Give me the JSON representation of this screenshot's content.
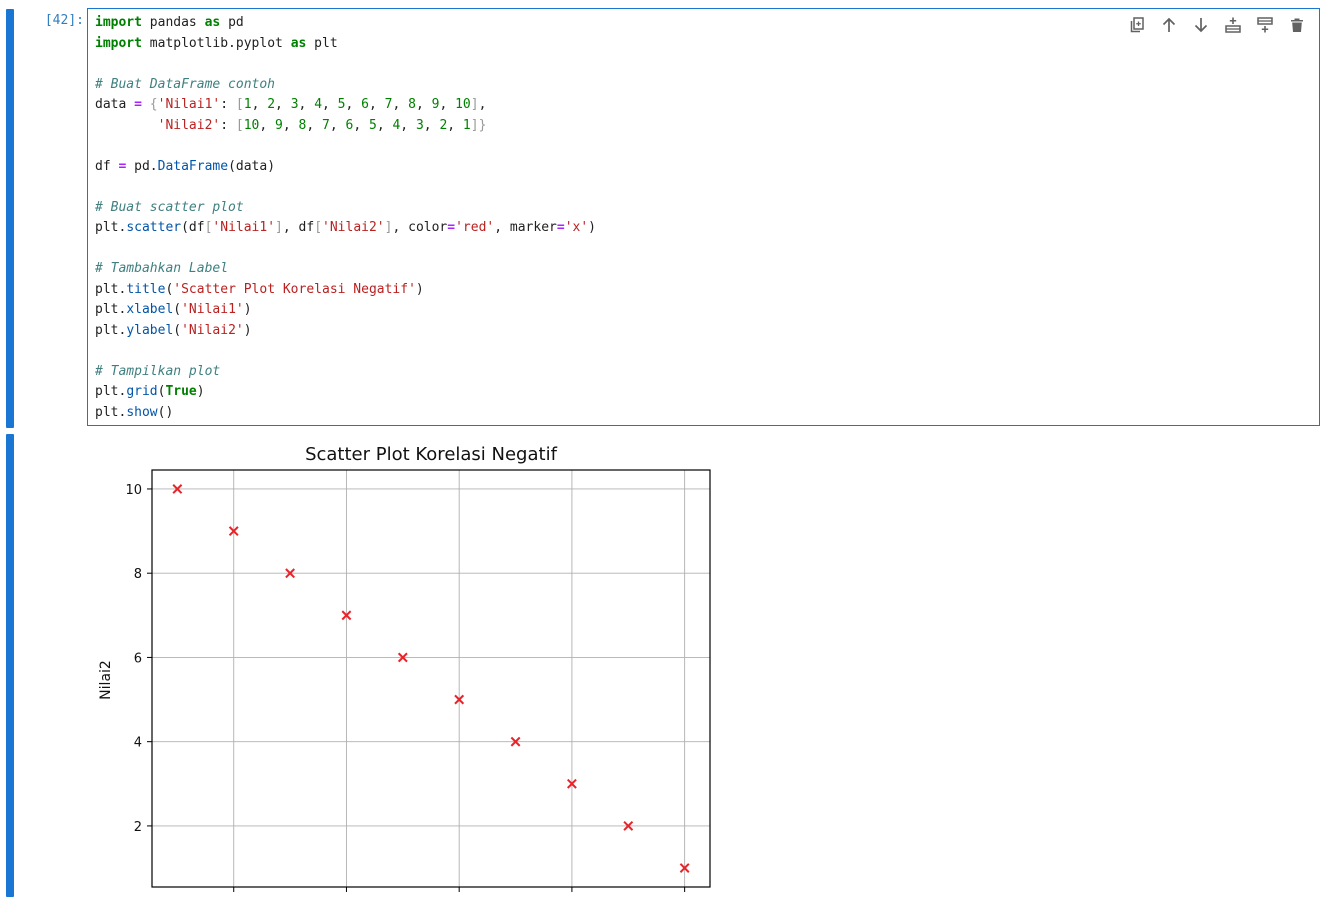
{
  "cell": {
    "prompt": "[42]:",
    "toolbar": [
      {
        "name": "duplicate-cell-icon",
        "title": "Duplicate"
      },
      {
        "name": "move-up-icon",
        "title": "Move up"
      },
      {
        "name": "move-down-icon",
        "title": "Move down"
      },
      {
        "name": "insert-above-icon",
        "title": "Insert above"
      },
      {
        "name": "insert-below-icon",
        "title": "Insert below"
      },
      {
        "name": "delete-cell-icon",
        "title": "Delete"
      }
    ],
    "code_lines": [
      "import pandas as pd",
      "import matplotlib.pyplot as plt",
      "",
      "# Buat DataFrame contoh",
      "data = {'Nilai1': [1, 2, 3, 4, 5, 6, 7, 8, 9, 10],",
      "        'Nilai2': [10, 9, 8, 7, 6, 5, 4, 3, 2, 1]}",
      "",
      "df = pd.DataFrame(data)",
      "",
      "# Buat scatter plot",
      "plt.scatter(df['Nilai1'], df['Nilai2'], color='red', marker='x')",
      "",
      "# Tambahkan Label",
      "plt.title('Scatter Plot Korelasi Negatif')",
      "plt.xlabel('Nilai1')",
      "plt.ylabel('Nilai2')",
      "",
      "# Tampilkan plot",
      "plt.grid(True)",
      "plt.show()"
    ]
  },
  "colors": {
    "accent": "#1976d2",
    "marker": "#e8242a"
  },
  "chart_data": {
    "type": "scatter",
    "title": "Scatter Plot Korelasi Negatif",
    "xlabel": "",
    "ylabel": "Nilai2",
    "x": [
      1,
      2,
      3,
      4,
      5,
      6,
      7,
      8,
      9,
      10
    ],
    "y": [
      10,
      9,
      8,
      7,
      6,
      5,
      4,
      3,
      2,
      1
    ],
    "marker": "x",
    "color": "red",
    "xlim": [
      0.55,
      10.45
    ],
    "ylim": [
      0.55,
      10.45
    ],
    "x_grid_ticks": [
      2,
      4,
      6,
      8,
      10
    ],
    "y_ticks": [
      2,
      4,
      6,
      8,
      10
    ],
    "y_tick_labels": [
      "2",
      "4",
      "6",
      "8",
      "10"
    ],
    "grid": true
  }
}
